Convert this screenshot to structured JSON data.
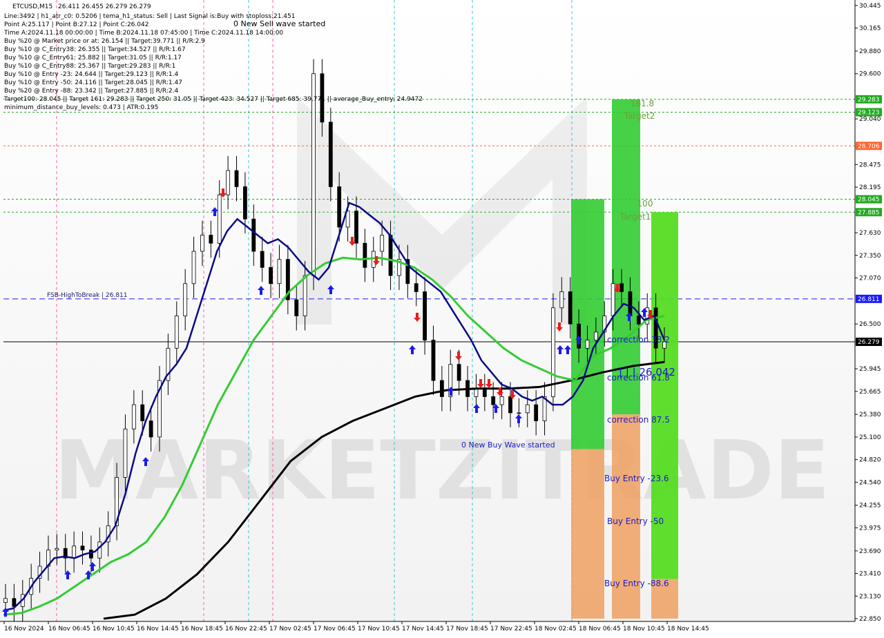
{
  "chart_data": {
    "type": "candlestick",
    "symbol_label": "ETCUSD,M15",
    "ohlc_text": "26.411 26.455 26.279 26.279",
    "info_lines": [
      "Line:3492 | h1_atr_c0: 0.5206 | tema_h1_status: Sell | Last Signal is:Buy with stoploss:21.451",
      "Point A:25.117 | Point B:27.12 | Point C:26.042",
      "Time A:2024.11.18 00:00:00 | Time B:2024.11.18 07:45:00 | Time C:2024.11.18 14:00:00",
      "Buy %20 @ Market price or at: 26.154 || Target:39.771 || R/R:2.9",
      "Buy %10 @ C_Entry38: 26.355 || Target:34.527 || R/R:1.67",
      "Buy %10 @ C_Entry61: 25.882 || Target:31.05 || R/R:1.17",
      "Buy %10 @ C_Entry88: 25.367 || Target:29.283 || R/R:1",
      "Buy %10 @ Entry -23: 24.644 || Target:29.123 || R/R:1.4",
      "Buy %10 @ Entry -50: 24.116 || Target:28.045 || R/R:1.47",
      "Buy %20 @ Entry -88: 23.342 || Target:27.885 || R/R:2.4",
      "Target100: 28.045 || Target 161: 29.283 || Target 250: 31.05 || Target 423: 34.527 || Target 685: 39.771 || average_Buy_entry: 24.9472",
      "minimum_distance_buy_levels: 0.473 | ATR:0.195"
    ],
    "annotations": {
      "sell_wave": "0 New Sell wave started",
      "buy_wave": "0 New Buy Wave started",
      "fsb": "FSB-HighToBreak | 26.811",
      "level_label": "| | | 26.042",
      "t161": "161.8",
      "target2": "Target2",
      "t100": "100",
      "target1": "Target1",
      "corr382": "correction 38.2",
      "corr618": "correction 61.8",
      "corr875": "correction 87.5",
      "be236": "Buy Entry -23.6",
      "be50": "Buy Entry -50",
      "be886": "Buy Entry -88.6",
      "watermark": "MARKETZITRADE"
    },
    "y_range": [
      22.85,
      30.47
    ],
    "y_ticks": [
      "30.445",
      "30.165",
      "29.880",
      "29.600",
      "29.040",
      "28.475",
      "28.195",
      "27.630",
      "27.350",
      "27.070",
      "26.500",
      "25.945",
      "25.665",
      "25.380",
      "25.100",
      "24.820",
      "24.540",
      "24.255",
      "23.975",
      "23.690",
      "23.410",
      "23.130",
      "22.850"
    ],
    "price_tags": [
      {
        "label": "29.283",
        "value": 29.283,
        "color": "#22aa22"
      },
      {
        "label": "29.123",
        "value": 29.123,
        "color": "#22aa22"
      },
      {
        "label": "28.706",
        "value": 28.706,
        "color": "#ff6633"
      },
      {
        "label": "28.045",
        "value": 28.045,
        "color": "#22aa22"
      },
      {
        "label": "27.885",
        "value": 27.885,
        "color": "#22aa22"
      },
      {
        "label": "26.811",
        "value": 26.811,
        "color": "#1a1aff"
      },
      {
        "label": "26.279",
        "value": 26.279,
        "color": "#000000"
      }
    ],
    "x_ticks": [
      "16 Nov 2024",
      "16 Nov 06:45",
      "16 Nov 10:45",
      "16 Nov 14:45",
      "16 Nov 18:45",
      "16 Nov 22:45",
      "17 Nov 02:45",
      "17 Nov 06:45",
      "17 Nov 10:45",
      "17 Nov 14:45",
      "17 Nov 18:45",
      "17 Nov 22:45",
      "18 Nov 02:45",
      "18 Nov 06:45",
      "18 Nov 10:45",
      "18 Nov 14:45"
    ],
    "series": [
      {
        "name": "close",
        "values": [
          23.1,
          23.0,
          23.15,
          23.35,
          23.5,
          23.7,
          23.72,
          23.6,
          23.75,
          23.7,
          23.6,
          23.8,
          24.0,
          24.6,
          25.2,
          25.5,
          25.3,
          25.1,
          25.8,
          26.2,
          26.6,
          27.0,
          27.4,
          27.6,
          27.5,
          28.1,
          28.4,
          28.2,
          27.8,
          27.4,
          27.2,
          27.0,
          27.3,
          26.8,
          26.6,
          27.1,
          29.6,
          29.0,
          28.2,
          27.7,
          27.9,
          27.5,
          27.2,
          27.4,
          27.6,
          27.1,
          27.3,
          27.0,
          26.9,
          26.3,
          25.8,
          25.6,
          26.0,
          25.8,
          25.6,
          25.7,
          25.6,
          25.5,
          25.6,
          25.4,
          25.4,
          25.5,
          25.3,
          25.6,
          26.7,
          26.9,
          26.5,
          26.2,
          26.3,
          26.4,
          26.6,
          27.0,
          26.9,
          26.6,
          26.5,
          26.7,
          26.2,
          26.28
        ]
      },
      {
        "name": "blue_ma",
        "values": [
          22.95,
          22.98,
          23.1,
          23.3,
          23.45,
          23.6,
          23.62,
          23.6,
          23.65,
          23.68,
          23.8,
          24.0,
          24.4,
          24.9,
          25.3,
          25.6,
          25.85,
          26.0,
          26.2,
          26.6,
          27.0,
          27.4,
          27.65,
          27.8,
          27.7,
          27.6,
          27.5,
          27.55,
          27.45,
          27.3,
          27.15,
          27.05,
          27.2,
          27.6,
          28.0,
          27.95,
          27.85,
          27.75,
          27.6,
          27.4,
          27.2,
          27.1,
          27.0,
          26.9,
          26.7,
          26.5,
          26.3,
          26.05,
          25.9,
          25.75,
          25.7,
          25.6,
          25.55,
          25.6,
          25.5,
          25.5,
          25.6,
          25.8,
          26.2,
          26.4,
          26.6,
          26.75,
          26.7,
          26.55,
          26.6,
          26.3
        ]
      },
      {
        "name": "green_ma",
        "values": [
          22.9,
          22.92,
          23.0,
          23.1,
          23.25,
          23.4,
          23.55,
          23.65,
          23.8,
          24.1,
          24.5,
          25.0,
          25.5,
          25.9,
          26.3,
          26.6,
          26.9,
          27.1,
          27.25,
          27.32,
          27.3,
          27.32,
          27.28,
          27.2,
          27.05,
          26.85,
          26.6,
          26.4,
          26.2,
          26.05,
          25.95,
          25.85,
          25.8,
          26.1,
          26.2,
          26.35,
          26.55,
          26.6
        ]
      },
      {
        "name": "black_ma",
        "values": [
          22.85,
          22.9,
          23.1,
          23.4,
          23.8,
          24.3,
          24.8,
          25.1,
          25.3,
          25.45,
          25.6,
          25.68,
          25.7,
          25.7,
          25.72,
          25.8,
          25.9,
          25.98,
          26.03
        ]
      }
    ]
  }
}
